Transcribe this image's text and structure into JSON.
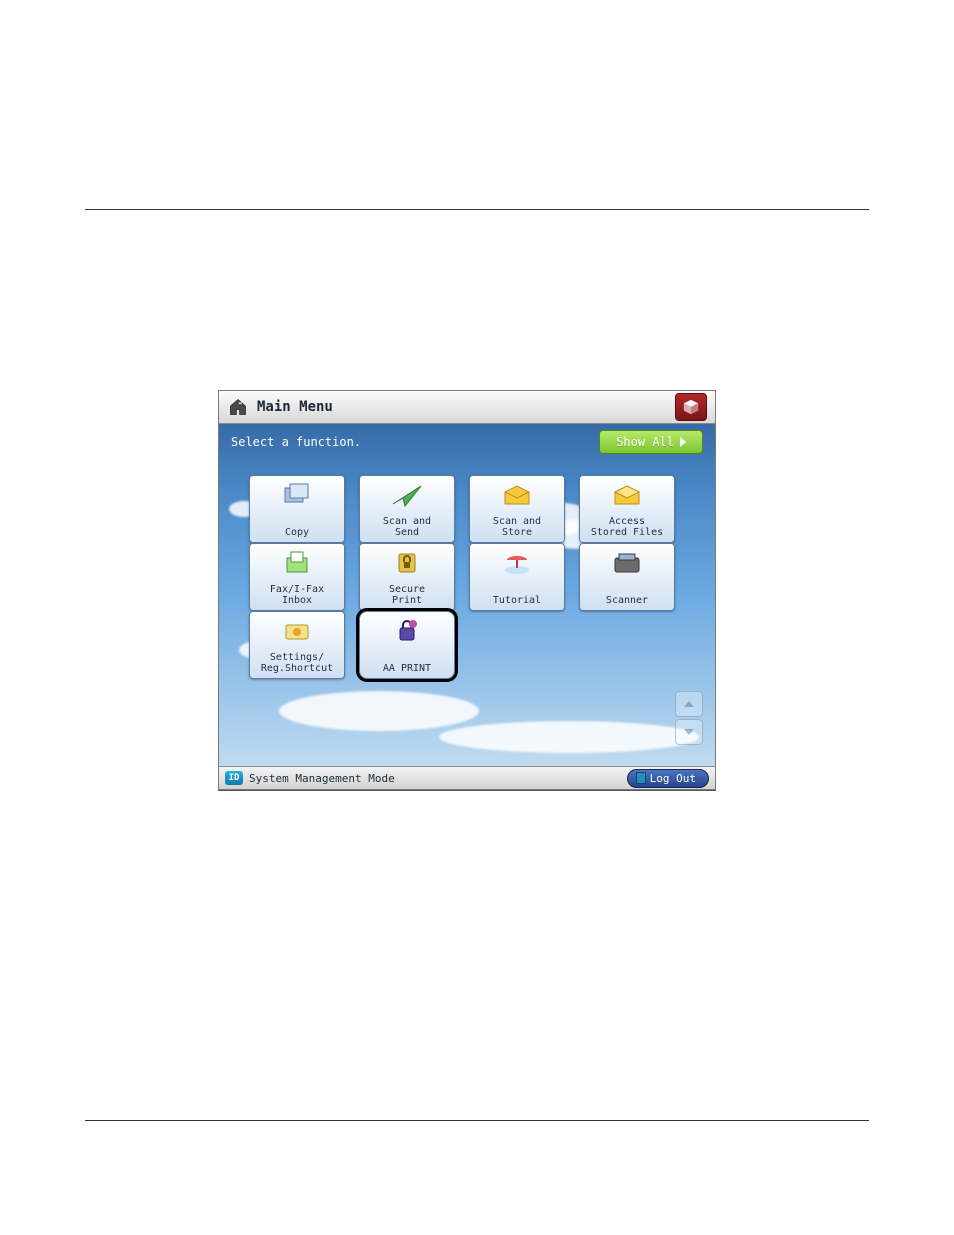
{
  "link_text": "",
  "screen": {
    "titlebar": {
      "title": "Main Menu"
    },
    "instruction": "Select a function.",
    "show_all": "Show All",
    "functions": [
      {
        "label": "Copy"
      },
      {
        "label": "Scan and\nSend"
      },
      {
        "label": "Scan and\nStore"
      },
      {
        "label": "Access\nStored Files"
      },
      {
        "label": "Fax/I-Fax\nInbox"
      },
      {
        "label": "Secure\nPrint"
      },
      {
        "label": "Tutorial"
      },
      {
        "label": "Scanner"
      },
      {
        "label": "Settings/\nReg.Shortcut"
      },
      {
        "label": "AA PRINT",
        "highlight": true
      }
    ],
    "bottombar": {
      "id_badge": "ID",
      "status": "System Management Mode",
      "logout": "Log Out"
    }
  }
}
